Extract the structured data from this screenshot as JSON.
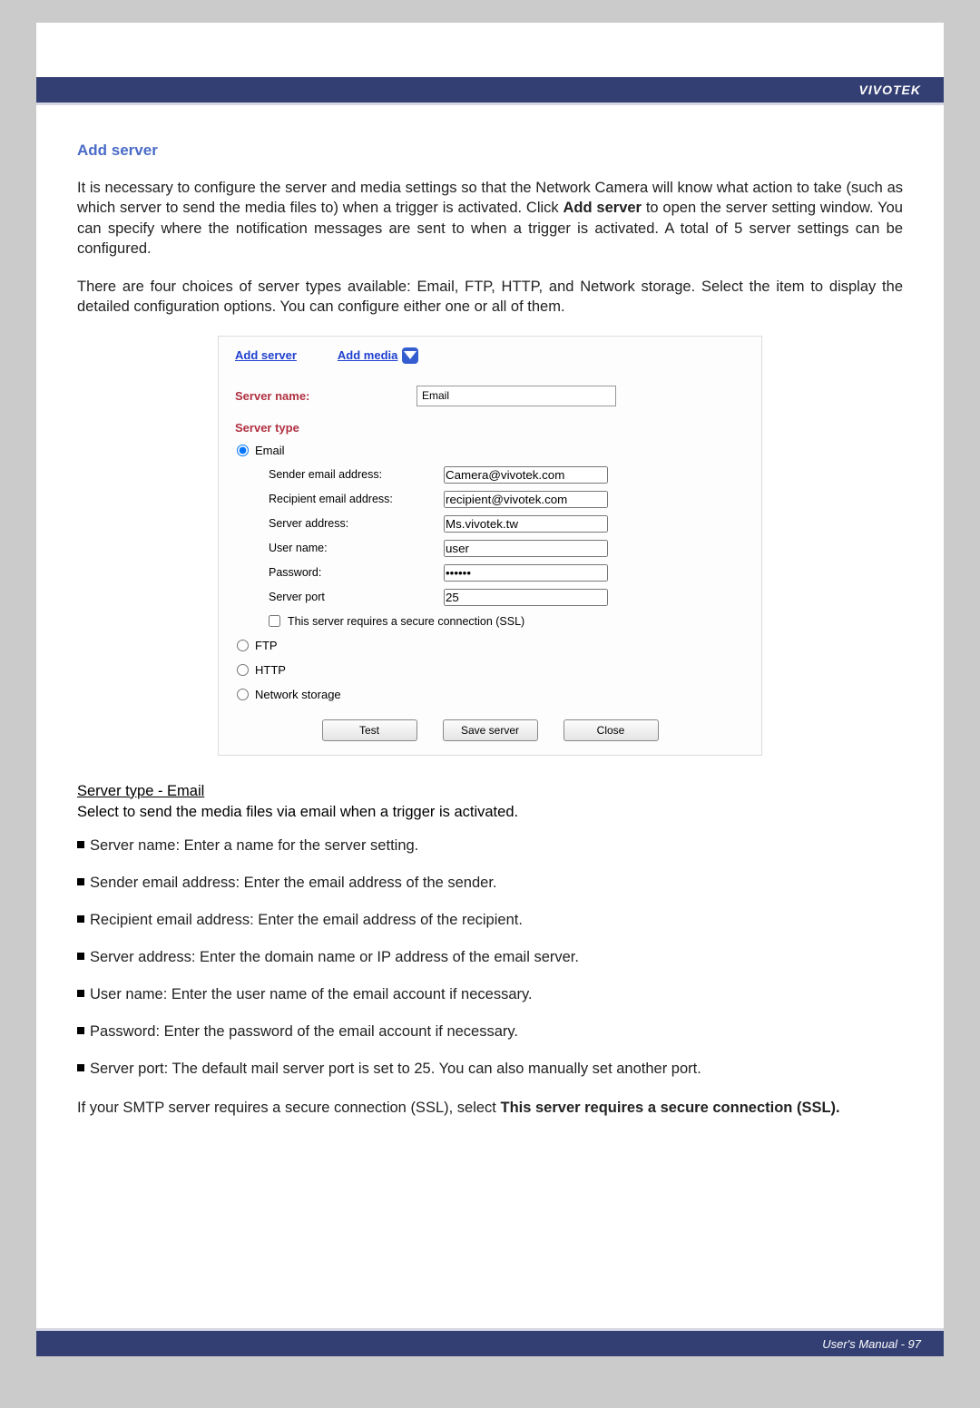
{
  "brand": "VIVOTEK",
  "section_title": "Add server",
  "para1_a": "It is necessary to configure the server and media settings so that the Network Camera will know what action to take (such as which server to send the media files to) when a trigger is activated. Click ",
  "para1_bold1": "Add server",
  "para1_b": " to open the server setting window. You can specify where the notification messages are sent to when a trigger is activated. A total of 5 server settings can be configured.",
  "para2": "There are four choices of server types available: Email, FTP, HTTP, and Network storage. Select the item to display the detailed configuration options. You can configure either one or all of them.",
  "shot": {
    "tab_add_server": "Add server",
    "tab_add_media": "Add media",
    "server_name_label": "Server name:",
    "server_name_value": "Email",
    "server_type_label": "Server type",
    "radio_email": "Email",
    "radio_ftp": "FTP",
    "radio_http": "HTTP",
    "radio_network_storage": "Network storage",
    "sender_label": "Sender email address:",
    "sender_value": "Camera@vivotek.com",
    "recipient_label": "Recipient email address:",
    "recipient_value": "recipient@vivotek.com",
    "server_addr_label": "Server address:",
    "server_addr_value": "Ms.vivotek.tw",
    "username_label": "User name:",
    "username_value": "user",
    "password_label": "Password:",
    "password_value": "••••••",
    "server_port_label": "Server port",
    "server_port_value": "25",
    "ssl_label": "This server requires a secure connection (SSL)",
    "btn_test": "Test",
    "btn_save": "Save server",
    "btn_close": "Close"
  },
  "subtitle": "Server type - Email",
  "subdesc": "Select to send the media files via email when a trigger is activated.",
  "bullets": [
    "Server name: Enter a name for the server setting.",
    "Sender email address: Enter the email address of the sender.",
    "Recipient email address: Enter the email address of the recipient.",
    "Server address: Enter the domain name or IP address of the email server.",
    "User name: Enter the user name of the email account if necessary.",
    "Password: Enter the password of the email account if necessary.",
    "Server port: The default mail server port is set to 25. You can also manually set another port."
  ],
  "final_a": "If your SMTP server requires a secure connection (SSL), select ",
  "final_bold": "This server requires a secure connection (SSL).",
  "footer": "User's Manual - 97"
}
